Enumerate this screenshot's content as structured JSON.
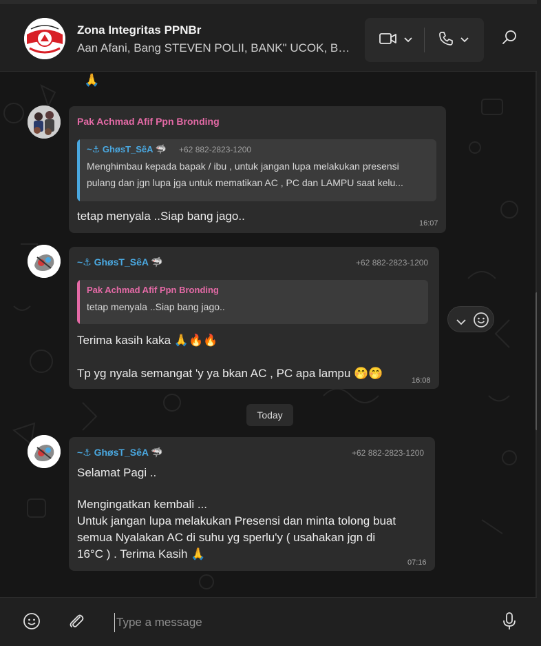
{
  "header": {
    "group_name": "Zona Integritas PPNBr",
    "members": "Aan Afani, Bang STEVEN POLII, BANK\" UCOK, Bu...",
    "video_icon": "video-camera-icon",
    "call_icon": "phone-icon",
    "search_icon": "search-icon"
  },
  "chat": {
    "top_emoji": "🙏",
    "messages": [
      {
        "sender": "Pak Achmad Afif Ppn Bronding",
        "sender_color": "#e46aa6",
        "quote": {
          "name": "~⚓ GhøsT_SêA 🦈",
          "phone": "+62 882-2823-1200",
          "text_line1": "Menghimbau kepada bapak / ibu , untuk jangan lupa melakukan presensi",
          "text_line2": "pulang dan jgn lupa jga untuk mematikan AC , PC dan LAMPU saat kelu..."
        },
        "text": "tetap menyala ..Siap bang jago..",
        "time": "16:07"
      },
      {
        "sender": "~⚓ GhøsT_SêA 🦈",
        "sender_color": "#4aa8e0",
        "phone": "+62 882-2823-1200",
        "quote": {
          "name": "Pak Achmad Afif Ppn Bronding",
          "text_line1": "tetap menyala ..Siap bang jago.."
        },
        "text_line1": "Terima kasih kaka 🙏🔥🔥",
        "text_line2": "Tp yg nyala semangat 'y ya bkan AC , PC apa lampu 🤭🤭",
        "time": "16:08"
      },
      {
        "sender": "~⚓ GhøsT_SêA 🦈",
        "sender_color": "#4aa8e0",
        "phone": "+62 882-2823-1200",
        "line1": "Selamat Pagi ..",
        "line2": "Mengingatkan kembali ...",
        "line3": "Untuk jangan lupa melakukan Presensi dan minta tolong buat",
        "line4": "semua Nyalakan AC di suhu yg sperlu'y ( usahakan jgn di",
        "line5": "16°C ) . Terima Kasih 🙏",
        "time": "07:16"
      }
    ],
    "date_separator": "Today"
  },
  "composer": {
    "placeholder": "Type a message",
    "emoji_icon": "emoji-icon",
    "attach_icon": "paperclip-icon",
    "mic_icon": "microphone-icon"
  }
}
